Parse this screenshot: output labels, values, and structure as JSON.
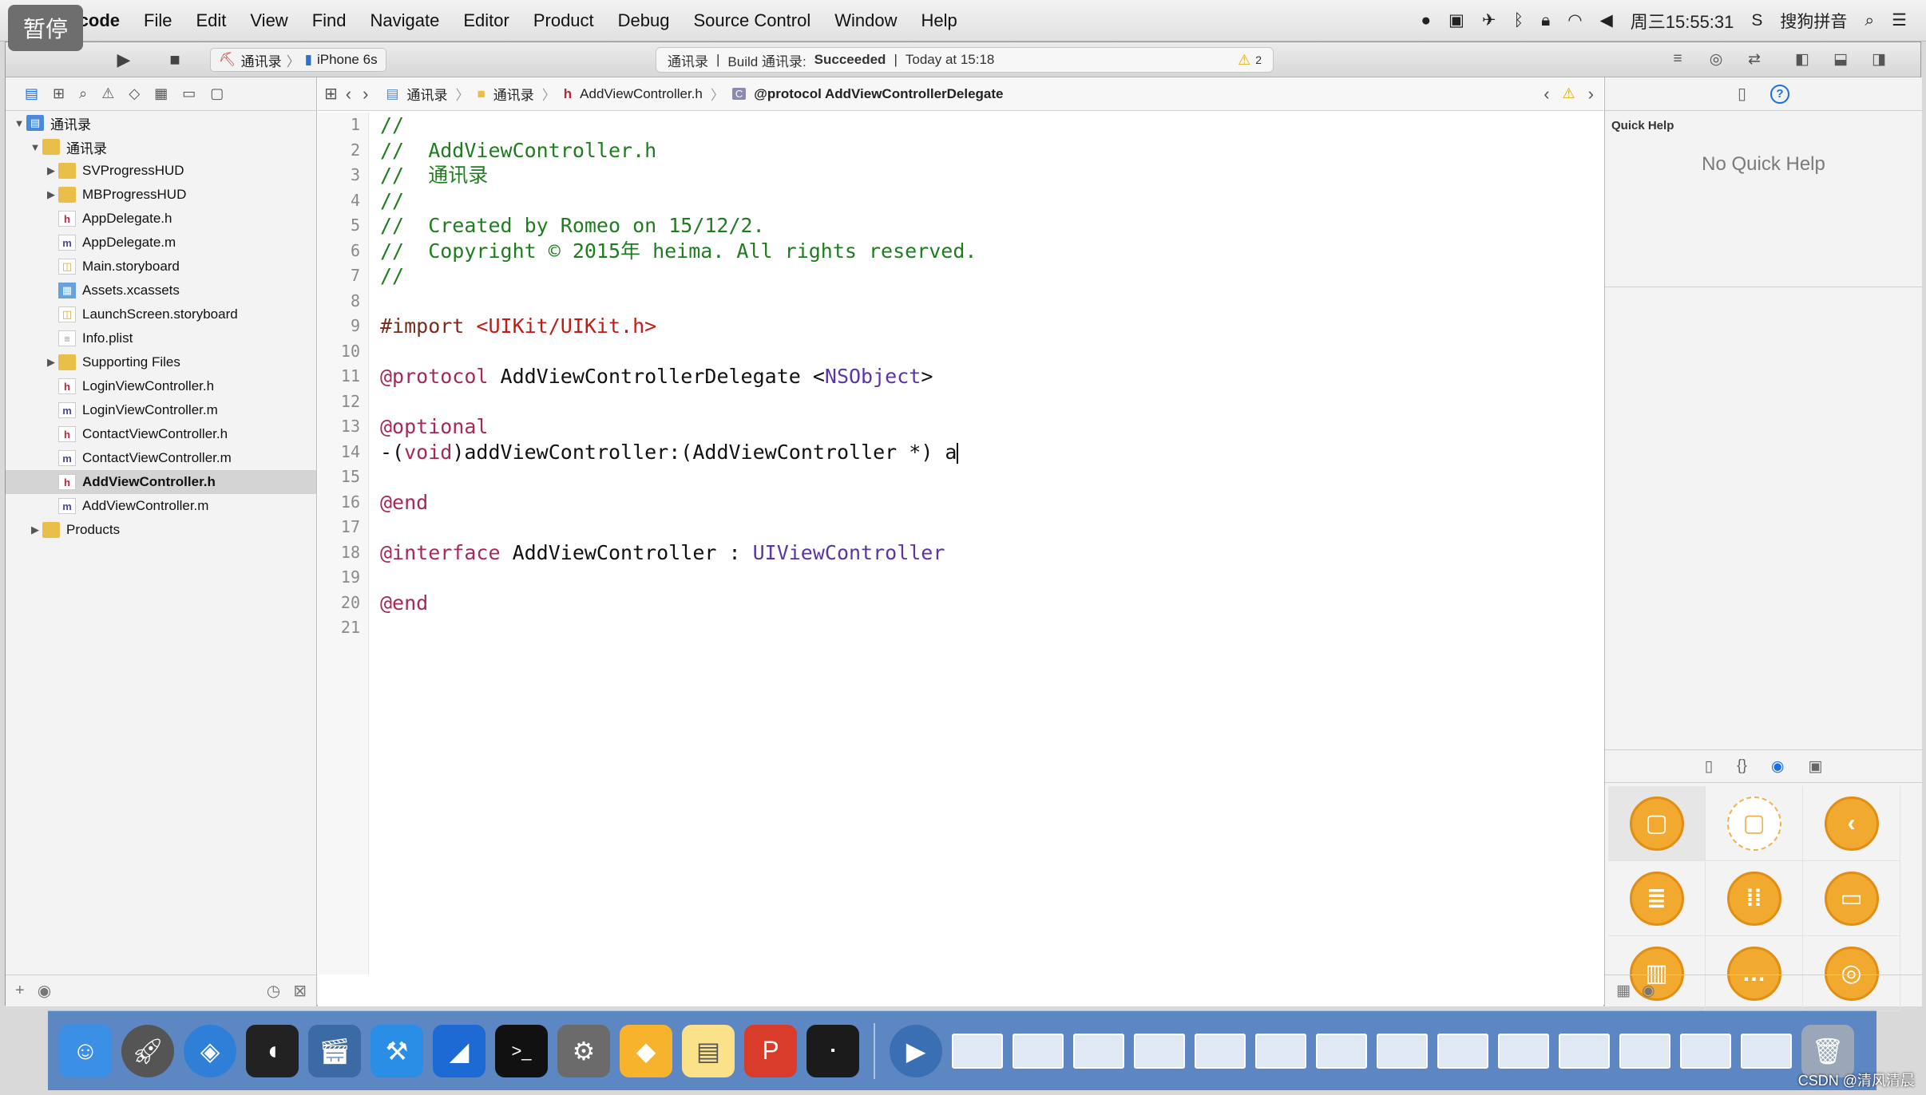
{
  "menubar": {
    "app_name": "Xcode",
    "items": [
      "File",
      "Edit",
      "View",
      "Find",
      "Navigate",
      "Editor",
      "Product",
      "Debug",
      "Source Control",
      "Window",
      "Help"
    ],
    "clock": "周三15:55:31",
    "input_method": "搜狗拼音"
  },
  "toolbar": {
    "pause_badge": "暂停",
    "scheme": "通讯录",
    "device": "iPhone 6s",
    "activity": {
      "project": "通讯录",
      "build_prefix": "Build 通讯录:",
      "build_status": "Succeeded",
      "time": "Today at 15:18",
      "warning_count": "2"
    }
  },
  "navigator": {
    "tree": [
      {
        "label": "通讯录",
        "icon": "project",
        "indent": 0,
        "disclosure": "▼"
      },
      {
        "label": "通讯录",
        "icon": "folder",
        "indent": 1,
        "disclosure": "▼"
      },
      {
        "label": "SVProgressHUD",
        "icon": "folder",
        "indent": 2,
        "disclosure": "▶"
      },
      {
        "label": "MBProgressHUD",
        "icon": "folder",
        "indent": 2,
        "disclosure": "▶"
      },
      {
        "label": "AppDelegate.h",
        "icon": "h",
        "indent": 2,
        "disclosure": ""
      },
      {
        "label": "AppDelegate.m",
        "icon": "m",
        "indent": 2,
        "disclosure": ""
      },
      {
        "label": "Main.storyboard",
        "icon": "sb",
        "indent": 2,
        "disclosure": ""
      },
      {
        "label": "Assets.xcassets",
        "icon": "assets",
        "indent": 2,
        "disclosure": ""
      },
      {
        "label": "LaunchScreen.storyboard",
        "icon": "sb",
        "indent": 2,
        "disclosure": ""
      },
      {
        "label": "Info.plist",
        "icon": "plist",
        "indent": 2,
        "disclosure": ""
      },
      {
        "label": "Supporting Files",
        "icon": "folder",
        "indent": 2,
        "disclosure": "▶"
      },
      {
        "label": "LoginViewController.h",
        "icon": "h",
        "indent": 2,
        "disclosure": ""
      },
      {
        "label": "LoginViewController.m",
        "icon": "m",
        "indent": 2,
        "disclosure": ""
      },
      {
        "label": "ContactViewController.h",
        "icon": "h",
        "indent": 2,
        "disclosure": ""
      },
      {
        "label": "ContactViewController.m",
        "icon": "m",
        "indent": 2,
        "disclosure": ""
      },
      {
        "label": "AddViewController.h",
        "icon": "h",
        "indent": 2,
        "disclosure": "",
        "selected": true
      },
      {
        "label": "AddViewController.m",
        "icon": "m",
        "indent": 2,
        "disclosure": ""
      },
      {
        "label": "Products",
        "icon": "folder",
        "indent": 1,
        "disclosure": "▶"
      }
    ]
  },
  "jump_bar": {
    "crumbs": [
      "通讯录",
      "通讯录",
      "AddViewController.h",
      "@protocol AddViewControllerDelegate"
    ]
  },
  "editor": {
    "lines": [
      [
        {
          "t": "//",
          "c": "comment"
        }
      ],
      [
        {
          "t": "//  AddViewController.h",
          "c": "comment"
        }
      ],
      [
        {
          "t": "//  通讯录",
          "c": "comment"
        }
      ],
      [
        {
          "t": "//",
          "c": "comment"
        }
      ],
      [
        {
          "t": "//  Created by Romeo on 15/12/2.",
          "c": "comment"
        }
      ],
      [
        {
          "t": "//  Copyright © 2015年 heima. All rights reserved.",
          "c": "comment"
        }
      ],
      [
        {
          "t": "//",
          "c": "comment"
        }
      ],
      [],
      [
        {
          "t": "#import ",
          "c": "pre"
        },
        {
          "t": "<UIKit/UIKit.h>",
          "c": "str"
        }
      ],
      [],
      [
        {
          "t": "@protocol",
          "c": "kw"
        },
        {
          "t": " AddViewControllerDelegate <",
          "c": "plain"
        },
        {
          "t": "NSObject",
          "c": "type"
        },
        {
          "t": ">",
          "c": "plain"
        }
      ],
      [],
      [
        {
          "t": "@optional",
          "c": "kw"
        }
      ],
      [
        {
          "t": "-(",
          "c": "plain"
        },
        {
          "t": "void",
          "c": "kw"
        },
        {
          "t": ")addViewController:(AddViewController *) a",
          "c": "plain"
        }
      ],
      [],
      [
        {
          "t": "@end",
          "c": "kw"
        }
      ],
      [],
      [
        {
          "t": "@interface",
          "c": "kw"
        },
        {
          "t": " AddViewController : ",
          "c": "plain"
        },
        {
          "t": "UIViewController",
          "c": "type"
        }
      ],
      [],
      [
        {
          "t": "@end",
          "c": "kw"
        }
      ],
      []
    ],
    "cursor_line": 14
  },
  "utilities": {
    "quick_help_title": "Quick Help",
    "quick_help_empty": "No Quick Help"
  },
  "watermark": "CSDN @清风清晨"
}
